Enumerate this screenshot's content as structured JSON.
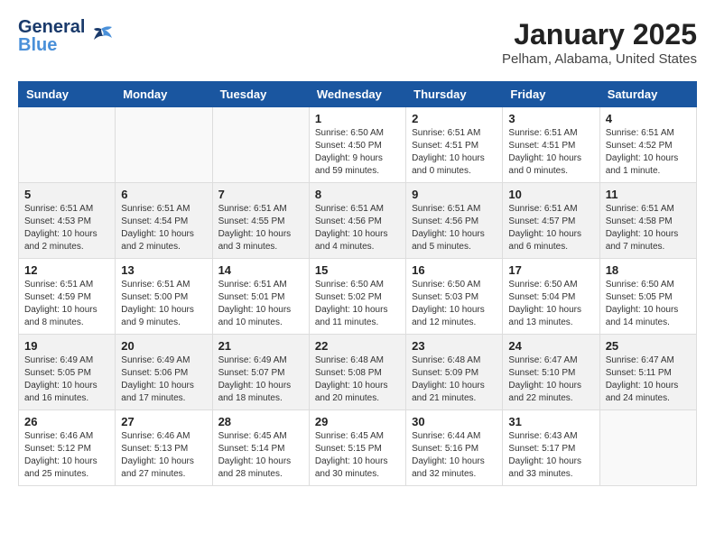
{
  "header": {
    "logo_line1": "General",
    "logo_line2": "Blue",
    "title": "January 2025",
    "subtitle": "Pelham, Alabama, United States"
  },
  "weekdays": [
    "Sunday",
    "Monday",
    "Tuesday",
    "Wednesday",
    "Thursday",
    "Friday",
    "Saturday"
  ],
  "weeks": [
    [
      {
        "day": "",
        "info": ""
      },
      {
        "day": "",
        "info": ""
      },
      {
        "day": "",
        "info": ""
      },
      {
        "day": "1",
        "info": "Sunrise: 6:50 AM\nSunset: 4:50 PM\nDaylight: 9 hours\nand 59 minutes."
      },
      {
        "day": "2",
        "info": "Sunrise: 6:51 AM\nSunset: 4:51 PM\nDaylight: 10 hours\nand 0 minutes."
      },
      {
        "day": "3",
        "info": "Sunrise: 6:51 AM\nSunset: 4:51 PM\nDaylight: 10 hours\nand 0 minutes."
      },
      {
        "day": "4",
        "info": "Sunrise: 6:51 AM\nSunset: 4:52 PM\nDaylight: 10 hours\nand 1 minute."
      }
    ],
    [
      {
        "day": "5",
        "info": "Sunrise: 6:51 AM\nSunset: 4:53 PM\nDaylight: 10 hours\nand 2 minutes."
      },
      {
        "day": "6",
        "info": "Sunrise: 6:51 AM\nSunset: 4:54 PM\nDaylight: 10 hours\nand 2 minutes."
      },
      {
        "day": "7",
        "info": "Sunrise: 6:51 AM\nSunset: 4:55 PM\nDaylight: 10 hours\nand 3 minutes."
      },
      {
        "day": "8",
        "info": "Sunrise: 6:51 AM\nSunset: 4:56 PM\nDaylight: 10 hours\nand 4 minutes."
      },
      {
        "day": "9",
        "info": "Sunrise: 6:51 AM\nSunset: 4:56 PM\nDaylight: 10 hours\nand 5 minutes."
      },
      {
        "day": "10",
        "info": "Sunrise: 6:51 AM\nSunset: 4:57 PM\nDaylight: 10 hours\nand 6 minutes."
      },
      {
        "day": "11",
        "info": "Sunrise: 6:51 AM\nSunset: 4:58 PM\nDaylight: 10 hours\nand 7 minutes."
      }
    ],
    [
      {
        "day": "12",
        "info": "Sunrise: 6:51 AM\nSunset: 4:59 PM\nDaylight: 10 hours\nand 8 minutes."
      },
      {
        "day": "13",
        "info": "Sunrise: 6:51 AM\nSunset: 5:00 PM\nDaylight: 10 hours\nand 9 minutes."
      },
      {
        "day": "14",
        "info": "Sunrise: 6:51 AM\nSunset: 5:01 PM\nDaylight: 10 hours\nand 10 minutes."
      },
      {
        "day": "15",
        "info": "Sunrise: 6:50 AM\nSunset: 5:02 PM\nDaylight: 10 hours\nand 11 minutes."
      },
      {
        "day": "16",
        "info": "Sunrise: 6:50 AM\nSunset: 5:03 PM\nDaylight: 10 hours\nand 12 minutes."
      },
      {
        "day": "17",
        "info": "Sunrise: 6:50 AM\nSunset: 5:04 PM\nDaylight: 10 hours\nand 13 minutes."
      },
      {
        "day": "18",
        "info": "Sunrise: 6:50 AM\nSunset: 5:05 PM\nDaylight: 10 hours\nand 14 minutes."
      }
    ],
    [
      {
        "day": "19",
        "info": "Sunrise: 6:49 AM\nSunset: 5:05 PM\nDaylight: 10 hours\nand 16 minutes."
      },
      {
        "day": "20",
        "info": "Sunrise: 6:49 AM\nSunset: 5:06 PM\nDaylight: 10 hours\nand 17 minutes."
      },
      {
        "day": "21",
        "info": "Sunrise: 6:49 AM\nSunset: 5:07 PM\nDaylight: 10 hours\nand 18 minutes."
      },
      {
        "day": "22",
        "info": "Sunrise: 6:48 AM\nSunset: 5:08 PM\nDaylight: 10 hours\nand 20 minutes."
      },
      {
        "day": "23",
        "info": "Sunrise: 6:48 AM\nSunset: 5:09 PM\nDaylight: 10 hours\nand 21 minutes."
      },
      {
        "day": "24",
        "info": "Sunrise: 6:47 AM\nSunset: 5:10 PM\nDaylight: 10 hours\nand 22 minutes."
      },
      {
        "day": "25",
        "info": "Sunrise: 6:47 AM\nSunset: 5:11 PM\nDaylight: 10 hours\nand 24 minutes."
      }
    ],
    [
      {
        "day": "26",
        "info": "Sunrise: 6:46 AM\nSunset: 5:12 PM\nDaylight: 10 hours\nand 25 minutes."
      },
      {
        "day": "27",
        "info": "Sunrise: 6:46 AM\nSunset: 5:13 PM\nDaylight: 10 hours\nand 27 minutes."
      },
      {
        "day": "28",
        "info": "Sunrise: 6:45 AM\nSunset: 5:14 PM\nDaylight: 10 hours\nand 28 minutes."
      },
      {
        "day": "29",
        "info": "Sunrise: 6:45 AM\nSunset: 5:15 PM\nDaylight: 10 hours\nand 30 minutes."
      },
      {
        "day": "30",
        "info": "Sunrise: 6:44 AM\nSunset: 5:16 PM\nDaylight: 10 hours\nand 32 minutes."
      },
      {
        "day": "31",
        "info": "Sunrise: 6:43 AM\nSunset: 5:17 PM\nDaylight: 10 hours\nand 33 minutes."
      },
      {
        "day": "",
        "info": ""
      }
    ]
  ]
}
